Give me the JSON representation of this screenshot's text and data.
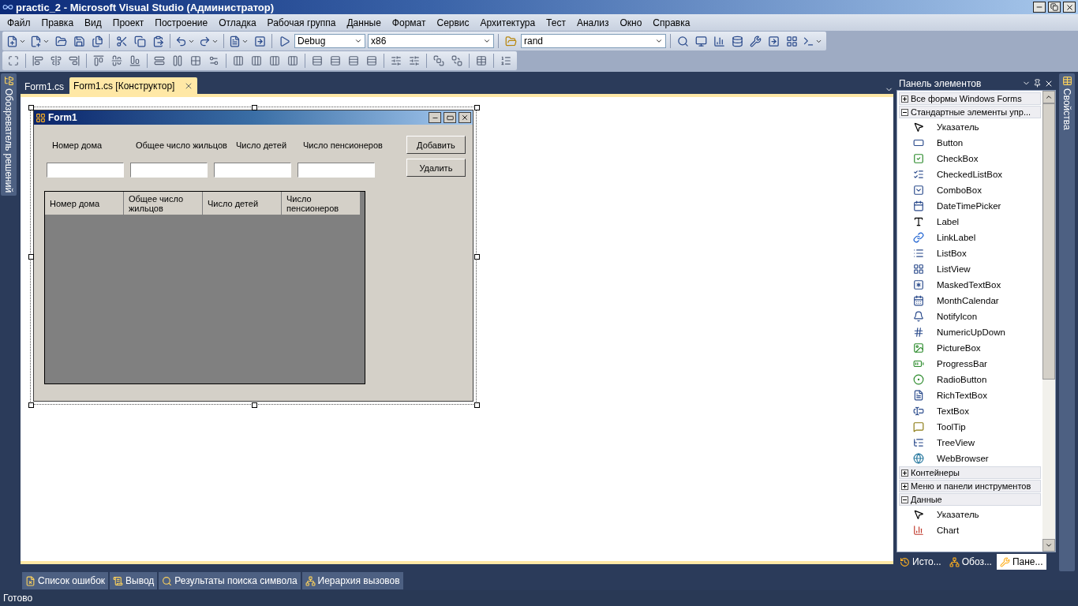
{
  "window": {
    "title": "practic_2 - Microsoft Visual Studio (Администратор)"
  },
  "menu": [
    "Файл",
    "Правка",
    "Вид",
    "Проект",
    "Построение",
    "Отладка",
    "Рабочая группа",
    "Данные",
    "Формат",
    "Сервис",
    "Архитектура",
    "Тест",
    "Анализ",
    "Окно",
    "Справка"
  ],
  "toolbar": {
    "configuration": "Debug",
    "platform": "x86",
    "search": "rand"
  },
  "side_tabs": {
    "left": "Обозреватель решений",
    "right": "Свойства"
  },
  "document_tabs": [
    {
      "label": "Form1.cs",
      "selected": false
    },
    {
      "label": "Form1.cs [Конструктор]",
      "selected": true
    }
  ],
  "designer_form": {
    "title": "Form1",
    "labels": [
      "Номер дома",
      "Общее число жильцов",
      "Число детей",
      "Число пенсионеров"
    ],
    "buttons": [
      "Добавить",
      "Удалить"
    ],
    "grid_columns": [
      "Номер дома",
      "Общее число жильцов",
      "Число детей",
      "Число пенсионеров"
    ]
  },
  "toolbox": {
    "title": "Панель элементов",
    "groups": [
      {
        "label": "Все формы Windows Forms",
        "expanded": false
      },
      {
        "label": "Стандартные элементы упр...",
        "expanded": true,
        "children": [
          {
            "label": "Указатель"
          },
          {
            "label": "Button"
          },
          {
            "label": "CheckBox"
          },
          {
            "label": "CheckedListBox"
          },
          {
            "label": "ComboBox"
          },
          {
            "label": "DateTimePicker"
          },
          {
            "label": "Label"
          },
          {
            "label": "LinkLabel"
          },
          {
            "label": "ListBox"
          },
          {
            "label": "ListView"
          },
          {
            "label": "MaskedTextBox"
          },
          {
            "label": "MonthCalendar"
          },
          {
            "label": "NotifyIcon"
          },
          {
            "label": "NumericUpDown"
          },
          {
            "label": "PictureBox"
          },
          {
            "label": "ProgressBar"
          },
          {
            "label": "RadioButton"
          },
          {
            "label": "RichTextBox"
          },
          {
            "label": "TextBox"
          },
          {
            "label": "ToolTip"
          },
          {
            "label": "TreeView"
          },
          {
            "label": "WebBrowser"
          }
        ]
      },
      {
        "label": "Контейнеры",
        "expanded": false
      },
      {
        "label": "Меню и панели инструментов",
        "expanded": false
      },
      {
        "label": "Данные",
        "expanded": true,
        "children": [
          {
            "label": "Указатель"
          },
          {
            "label": "Chart"
          }
        ]
      }
    ]
  },
  "panel_tabs": [
    {
      "label": "Исто...",
      "selected": false
    },
    {
      "label": "Обоз...",
      "selected": false
    },
    {
      "label": "Пане...",
      "selected": true
    }
  ],
  "tool_windows": [
    "Список ошибок",
    "Вывод",
    "Результаты поиска символа",
    "Иерархия вызовов"
  ],
  "status_bar": "Готово"
}
